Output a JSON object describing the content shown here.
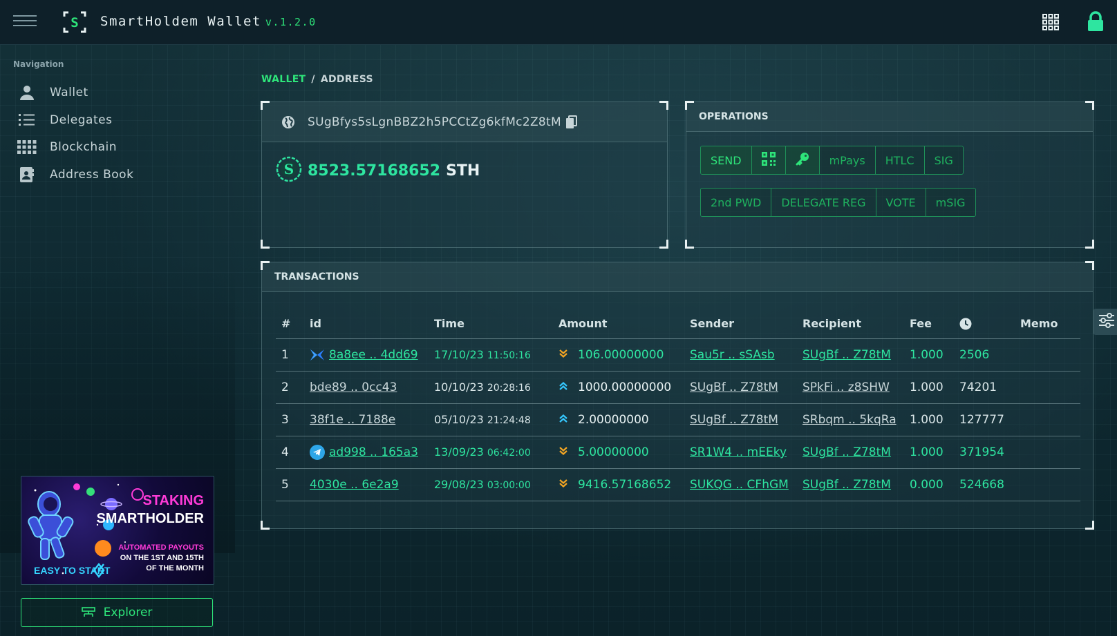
{
  "header": {
    "app_name": "SmartHoldem Wallet",
    "version": "v.1.2.0",
    "logo_letter": "S"
  },
  "sidebar": {
    "title": "Navigation",
    "items": [
      {
        "label": "Wallet",
        "icon": "user-icon"
      },
      {
        "label": "Delegates",
        "icon": "list-icon"
      },
      {
        "label": "Blockchain",
        "icon": "grid-icon"
      },
      {
        "label": "Address Book",
        "icon": "contact-icon"
      }
    ],
    "promo": {
      "staking": "STAKING",
      "brand": "SMARTHOLDER",
      "automated": "AUTOMATED PAYOUTS",
      "schedule_line1": "ON THE 1ST AND 15TH",
      "schedule_line2": "OF THE MONTH",
      "easy": "EASY TO START"
    },
    "explorer_label": "Explorer"
  },
  "breadcrumb": {
    "wallet": "WALLET",
    "separator": "/",
    "address": "ADDRESS"
  },
  "address_panel": {
    "address": "SUgBfys5sLgnBBZ2h5PCCtZg6kfMc2Z8tM",
    "balance": "8523.57168652",
    "unit": "STH"
  },
  "operations": {
    "title": "OPERATIONS",
    "row1": [
      "SEND",
      "mPays",
      "HTLC",
      "SIG"
    ],
    "row2": [
      "2nd PWD",
      "DELEGATE REG",
      "VOTE",
      "mSIG"
    ]
  },
  "transactions": {
    "title": "TRANSACTIONS",
    "columns": [
      "#",
      "id",
      "Time",
      "Amount",
      "Sender",
      "Recipient",
      "Fee",
      "",
      "Memo"
    ],
    "rows": [
      {
        "n": "1",
        "id": "8a8ee .. 4dd69",
        "date": "17/10/23",
        "clock": "11:50:16",
        "dir": "in",
        "amount": "106.00000000",
        "sender": "Sau5r .. sSAsb",
        "recipient": "SUgBf .. Z78tM",
        "fee": "1.000",
        "confirmations": "2506",
        "memo": "",
        "icon": "smartholder-icon",
        "self_is": "recipient"
      },
      {
        "n": "2",
        "id": "bde89 .. 0cc43",
        "date": "10/10/23",
        "clock": "20:28:16",
        "dir": "out",
        "amount": "1000.00000000",
        "sender": "SUgBf .. Z78tM",
        "recipient": "SPkFi .. z8SHW",
        "fee": "1.000",
        "confirmations": "74201",
        "memo": "",
        "icon": "",
        "self_is": "sender"
      },
      {
        "n": "3",
        "id": "38f1e .. 7188e",
        "date": "05/10/23",
        "clock": "21:24:48",
        "dir": "out",
        "amount": "2.00000000",
        "sender": "SUgBf .. Z78tM",
        "recipient": "SRbqm .. 5kqRa",
        "fee": "1.000",
        "confirmations": "127777",
        "memo": "",
        "icon": "",
        "self_is": "sender"
      },
      {
        "n": "4",
        "id": "ad998 .. 165a3",
        "date": "13/09/23",
        "clock": "06:42:00",
        "dir": "in",
        "amount": "5.00000000",
        "sender": "SR1W4 .. mEEky",
        "recipient": "SUgBf .. Z78tM",
        "fee": "1.000",
        "confirmations": "371954",
        "memo": "",
        "icon": "telegram-icon",
        "self_is": "recipient"
      },
      {
        "n": "5",
        "id": "4030e .. 6e2a9",
        "date": "29/08/23",
        "clock": "03:00:00",
        "dir": "in",
        "amount": "9416.57168652",
        "sender": "SUKQG .. CFhGM",
        "recipient": "SUgBf .. Z78tM",
        "fee": "0.000",
        "confirmations": "524668",
        "memo": "",
        "icon": "",
        "self_is": "recipient"
      }
    ]
  },
  "colors": {
    "accent_green": "#2ee57a",
    "teal": "#2ee5a0",
    "in_arrow": "#f5a623",
    "out_arrow": "#35c8ff"
  }
}
